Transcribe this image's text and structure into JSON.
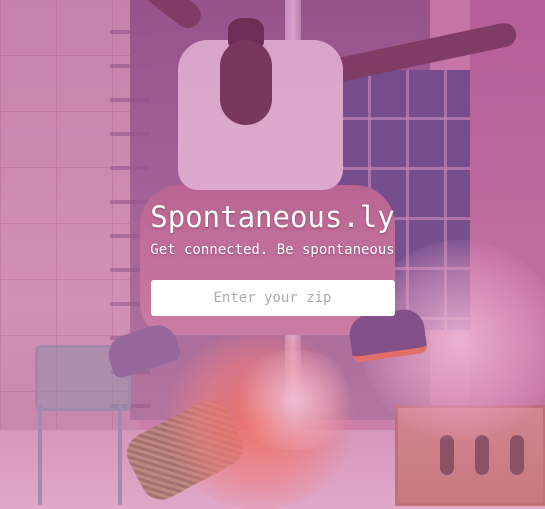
{
  "page": {
    "overlay_color": "#c04696"
  },
  "hero": {
    "title": "Spontaneous.ly",
    "tagline": "Get connected. Be spontaneous"
  },
  "search": {
    "zip_placeholder": "Enter your zip",
    "zip_value": ""
  }
}
